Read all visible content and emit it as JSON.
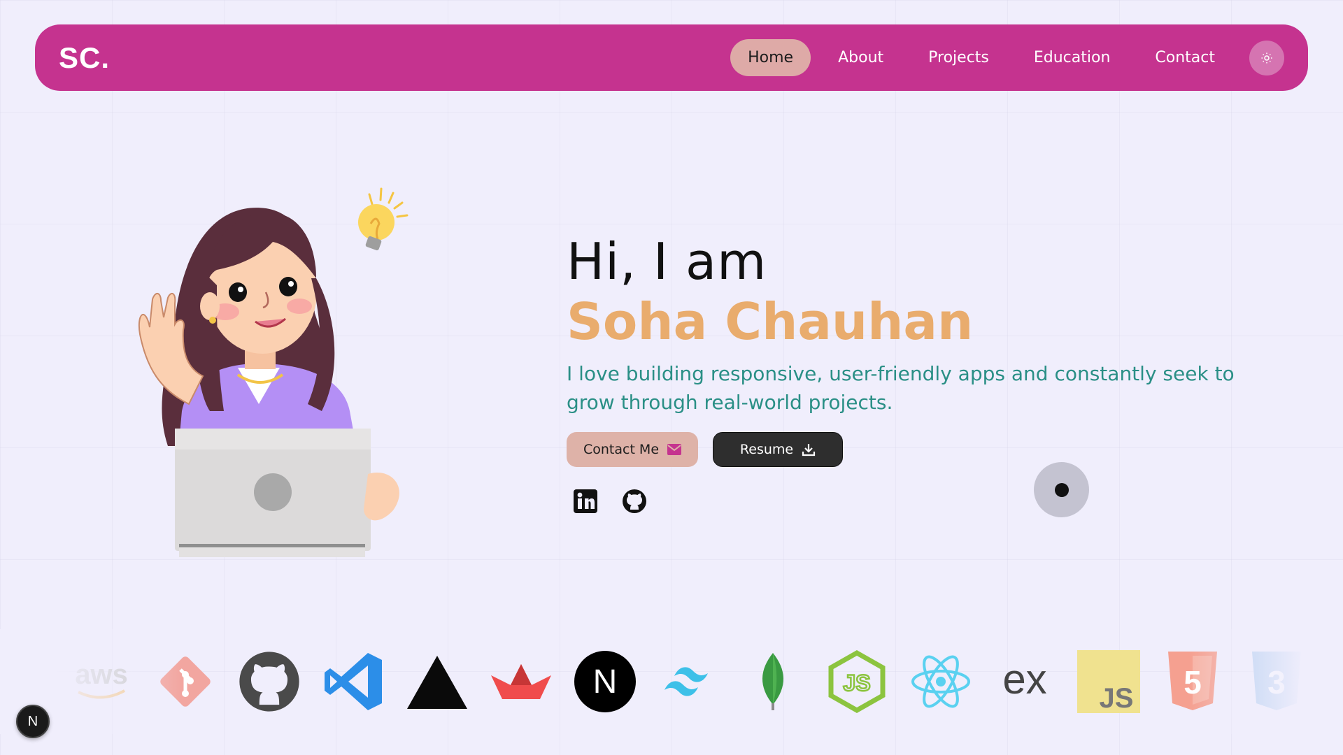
{
  "nav": {
    "logo": "SC.",
    "items": [
      {
        "label": "Home",
        "active": true
      },
      {
        "label": "About",
        "active": false
      },
      {
        "label": "Projects",
        "active": false
      },
      {
        "label": "Education",
        "active": false
      },
      {
        "label": "Contact",
        "active": false
      }
    ],
    "theme_icon": "sun-icon",
    "color": "#c5338f"
  },
  "hero": {
    "greeting": "Hi, I am",
    "name": "Soha Chauhan",
    "tagline": "I love building responsive, user-friendly apps and constantly seek to grow through real-world projects.",
    "contact_label": "Contact Me",
    "contact_icon": "envelope-icon",
    "resume_label": "Resume",
    "resume_icon": "download-icon",
    "socials": [
      "linkedin-icon",
      "github-icon"
    ],
    "name_color": "#e9ac6d",
    "tagline_color": "#2a8f86"
  },
  "tech_stack": {
    "icons": [
      "aws-icon",
      "git-icon",
      "github-icon",
      "vscode-icon",
      "vercel-icon",
      "streamlit-icon",
      "nextjs-icon",
      "tailwind-icon",
      "mongodb-icon",
      "nodejs-icon",
      "react-icon",
      "express-icon",
      "javascript-icon",
      "html5-icon",
      "css3-icon"
    ],
    "aws_text": "aws",
    "express_text": "ex",
    "js_text": "JS",
    "nextjs_text": "N",
    "html_text": "5",
    "css_text": "3"
  },
  "dev_badge": "N"
}
